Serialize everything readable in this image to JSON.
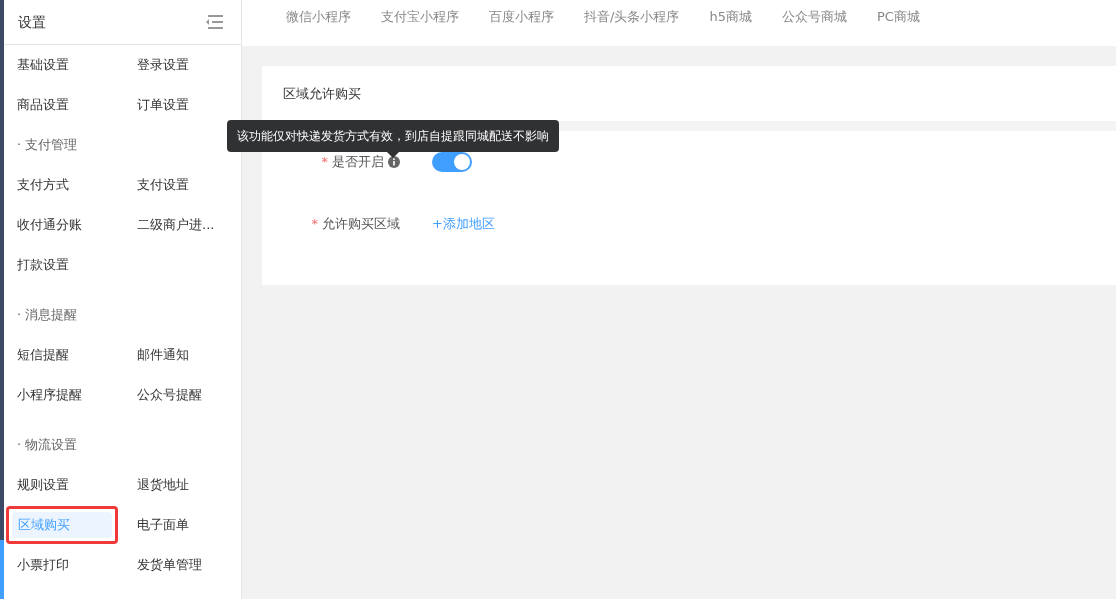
{
  "sidebar": {
    "title": "设置",
    "groups": [
      {
        "items": [
          {
            "label": "基础设置",
            "selected": false
          },
          {
            "label": "登录设置",
            "selected": false
          },
          {
            "label": "商品设置",
            "selected": false
          },
          {
            "label": "订单设置",
            "selected": false
          }
        ]
      },
      {
        "heading": "· 支付管理",
        "items": [
          {
            "label": "支付方式",
            "selected": false
          },
          {
            "label": "支付设置",
            "selected": false
          },
          {
            "label": "收付通分账",
            "selected": false
          },
          {
            "label": "二级商户进...",
            "selected": false
          },
          {
            "label": "打款设置",
            "selected": false
          }
        ]
      },
      {
        "heading": "· 消息提醒",
        "items": [
          {
            "label": "短信提醒",
            "selected": false
          },
          {
            "label": "邮件通知",
            "selected": false
          },
          {
            "label": "小程序提醒",
            "selected": false
          },
          {
            "label": "公众号提醒",
            "selected": false
          }
        ]
      },
      {
        "heading": "· 物流设置",
        "items": [
          {
            "label": "规则设置",
            "selected": false
          },
          {
            "label": "退货地址",
            "selected": false
          },
          {
            "label": "区域购买",
            "selected": true
          },
          {
            "label": "电子面单",
            "selected": false
          },
          {
            "label": "小票打印",
            "selected": false
          },
          {
            "label": "发货单管理",
            "selected": false
          }
        ]
      }
    ]
  },
  "tabs": [
    "微信小程序",
    "支付宝小程序",
    "百度小程序",
    "抖音/头条小程序",
    "h5商城",
    "公众号商城",
    "PC商城"
  ],
  "card": {
    "title": "区域允许购买",
    "tooltip": "该功能仅对快递发货方式有效，到店自提跟同城配送不影响",
    "fields": [
      {
        "kind": "switch",
        "label": "是否开启",
        "required_mark": "*",
        "on": true
      },
      {
        "kind": "link",
        "label": "允许购买区域",
        "required_mark": "*",
        "action": "+添加地区"
      }
    ]
  }
}
